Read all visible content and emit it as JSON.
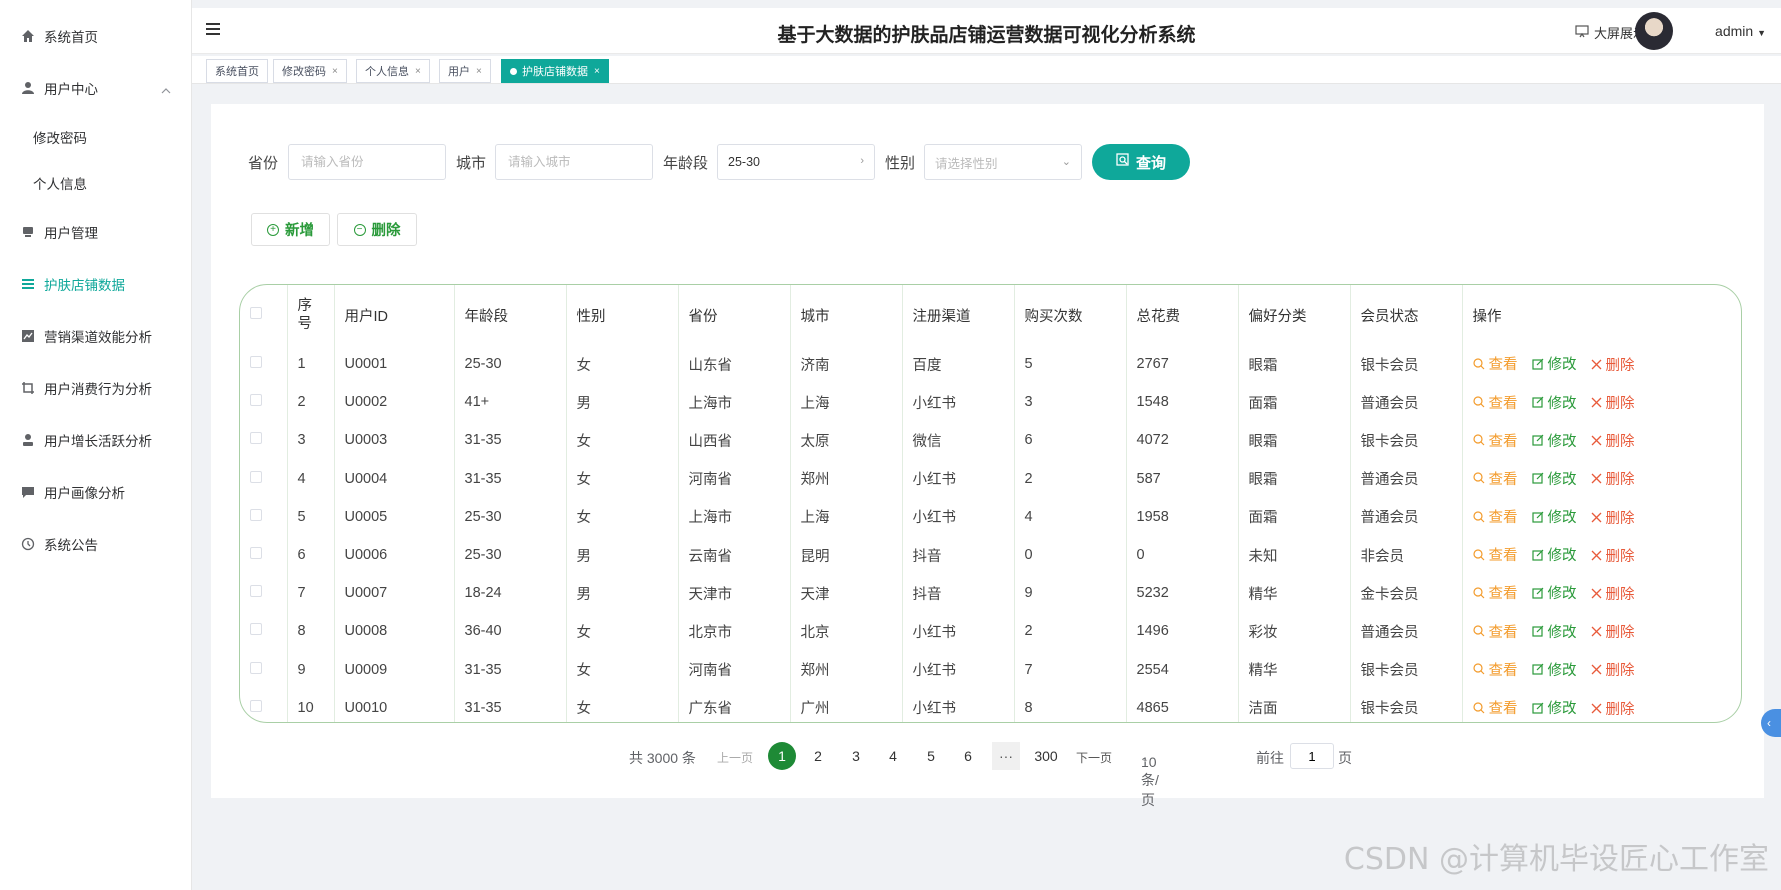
{
  "sidebar": {
    "items": [
      {
        "label": "系统首页",
        "icon": "home-icon"
      },
      {
        "label": "用户中心",
        "icon": "user-icon"
      },
      {
        "label": "修改密码"
      },
      {
        "label": "个人信息"
      },
      {
        "label": "用户管理",
        "icon": "user-manage-icon"
      },
      {
        "label": "护肤店铺数据",
        "icon": "list-icon"
      },
      {
        "label": "营销渠道效能分析",
        "icon": "chart-icon"
      },
      {
        "label": "用户消费行为分析",
        "icon": "crop-icon"
      },
      {
        "label": "用户增长活跃分析",
        "icon": "person-icon"
      },
      {
        "label": "用户画像分析",
        "icon": "chat-icon"
      },
      {
        "label": "系统公告",
        "icon": "clock-icon"
      }
    ]
  },
  "header": {
    "title": "基于大数据的护肤品店铺运营数据可视化分析系统",
    "big_screen": "大屏展示",
    "user": "admin"
  },
  "tabs": [
    "系统首页",
    "修改密码",
    "个人信息",
    "用户",
    "护肤店铺数据"
  ],
  "search": {
    "province_label": "省份",
    "province_placeholder": "请输入省份",
    "city_label": "城市",
    "city_placeholder": "请输入城市",
    "age_label": "年龄段",
    "age_value": "25-30",
    "gender_label": "性别",
    "gender_placeholder": "请选择性别",
    "query_label": "查询"
  },
  "actions": {
    "add": "新增",
    "delete": "删除"
  },
  "table": {
    "headers": [
      "序号",
      "用户ID",
      "年龄段",
      "性别",
      "省份",
      "城市",
      "注册渠道",
      "购买次数",
      "总花费",
      "偏好分类",
      "会员状态",
      "操作"
    ],
    "rows": [
      [
        "1",
        "U0001",
        "25-30",
        "女",
        "山东省",
        "济南",
        "百度",
        "5",
        "2767",
        "眼霜",
        "银卡会员"
      ],
      [
        "2",
        "U0002",
        "41+",
        "男",
        "上海市",
        "上海",
        "小红书",
        "3",
        "1548",
        "面霜",
        "普通会员"
      ],
      [
        "3",
        "U0003",
        "31-35",
        "女",
        "山西省",
        "太原",
        "微信",
        "6",
        "4072",
        "眼霜",
        "银卡会员"
      ],
      [
        "4",
        "U0004",
        "31-35",
        "女",
        "河南省",
        "郑州",
        "小红书",
        "2",
        "587",
        "眼霜",
        "普通会员"
      ],
      [
        "5",
        "U0005",
        "25-30",
        "女",
        "上海市",
        "上海",
        "小红书",
        "4",
        "1958",
        "面霜",
        "普通会员"
      ],
      [
        "6",
        "U0006",
        "25-30",
        "男",
        "云南省",
        "昆明",
        "抖音",
        "0",
        "0",
        "未知",
        "非会员"
      ],
      [
        "7",
        "U0007",
        "18-24",
        "男",
        "天津市",
        "天津",
        "抖音",
        "9",
        "5232",
        "精华",
        "金卡会员"
      ],
      [
        "8",
        "U0008",
        "36-40",
        "女",
        "北京市",
        "北京",
        "小红书",
        "2",
        "1496",
        "彩妆",
        "普通会员"
      ],
      [
        "9",
        "U0009",
        "31-35",
        "女",
        "河南省",
        "郑州",
        "小红书",
        "7",
        "2554",
        "精华",
        "银卡会员"
      ],
      [
        "10",
        "U0010",
        "31-35",
        "女",
        "广东省",
        "广州",
        "小红书",
        "8",
        "4865",
        "洁面",
        "银卡会员"
      ]
    ],
    "ops": {
      "view": "查看",
      "edit": "修改",
      "delete": "删除"
    }
  },
  "pagination": {
    "total": "共 3000 条",
    "prev": "上一页",
    "pages": [
      "1",
      "2",
      "3",
      "4",
      "5",
      "6"
    ],
    "more": "···",
    "last": "300",
    "next": "下一页",
    "page_size": "10条/页",
    "goto": "前往",
    "goto_value": "1",
    "page_unit": "页"
  },
  "watermark": "CSDN @计算机毕设匠心工作室",
  "colors": {
    "accent": "#0fa89a",
    "green": "#2a9a3a",
    "orange": "#f39b2b",
    "red": "#e85a3a"
  }
}
